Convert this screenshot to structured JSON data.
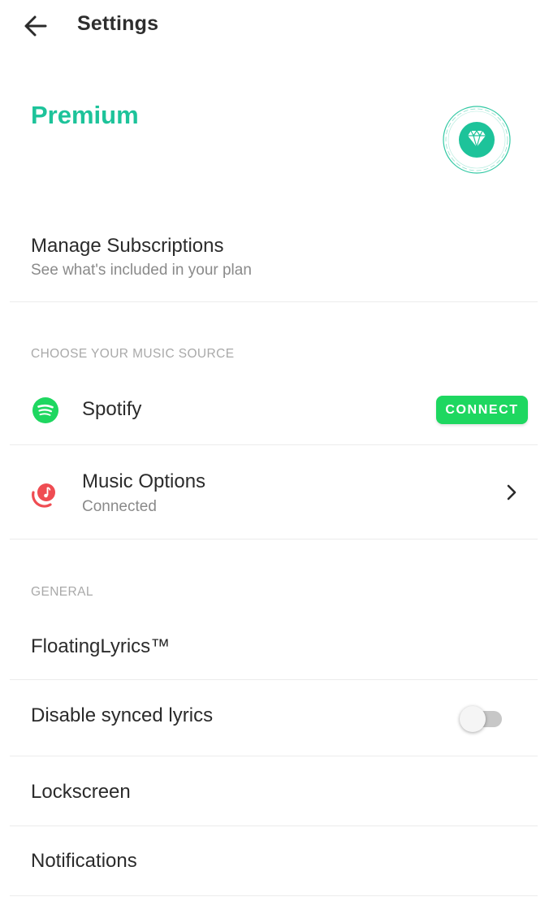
{
  "header": {
    "title": "Settings",
    "back_icon": "arrow-left-icon"
  },
  "premium": {
    "title": "Premium",
    "badge_icon": "diamond-badge-icon",
    "accent": "#1dc39a"
  },
  "subscriptions": {
    "title": "Manage Subscriptions",
    "subtitle": "See what's included in your plan"
  },
  "music_source": {
    "section_label": "CHOOSE YOUR MUSIC SOURCE",
    "spotify": {
      "label": "Spotify",
      "icon": "spotify-icon",
      "button": "CONNECT",
      "button_color": "#1ed760"
    },
    "music_options": {
      "label": "Music Options",
      "status": "Connected",
      "icon": "music-note-icon",
      "chevron": "chevron-right-icon"
    }
  },
  "general": {
    "section_label": "GENERAL",
    "items": [
      {
        "label": "FloatingLyrics™"
      },
      {
        "label": "Disable synced lyrics",
        "toggle_on": false
      },
      {
        "label": "Lockscreen"
      },
      {
        "label": "Notifications"
      }
    ]
  }
}
